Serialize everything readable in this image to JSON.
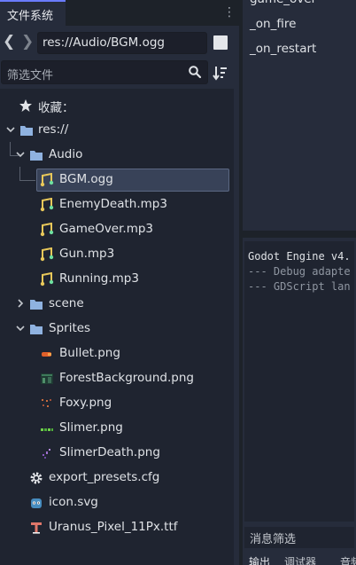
{
  "dock": {
    "tab_label": "文件系统",
    "menu_icon": "⋮",
    "nav_back": "❮",
    "nav_forward": "❯",
    "path": "res://Audio/BGM.ogg",
    "filter_placeholder": "筛选文件"
  },
  "tree": {
    "favorites_label": "收藏：",
    "root_label": "res://",
    "audio_folder": "Audio",
    "audio_files": [
      "BGM.ogg",
      "EnemyDeath.mp3",
      "GameOver.mp3",
      "Gun.mp3",
      "Running.mp3"
    ],
    "scene_folder": "scene",
    "sprites_folder": "Sprites",
    "sprite_files": [
      "Bullet.png",
      "ForestBackground.png",
      "Foxy.png",
      "Slimer.png",
      "SlimerDeath.png"
    ],
    "root_files": [
      "export_presets.cfg",
      "icon.svg",
      "Uranus_Pixel_11Px.ttf"
    ],
    "selected": "BGM.ogg"
  },
  "signals": {
    "items": [
      "game_over",
      "_on_fire",
      "_on_restart"
    ]
  },
  "output": {
    "lines": [
      "Godot Engine v4.",
      "--- Debug adapte",
      "--- GDScript lan"
    ],
    "filter_label": "消息筛选",
    "tabs": [
      "输出",
      "调试器",
      "音频"
    ]
  },
  "colors": {
    "accent": "#6a7cff",
    "folder": "#8fb2e0",
    "audio_icon": "#e8c85a",
    "selection": "#384258"
  }
}
